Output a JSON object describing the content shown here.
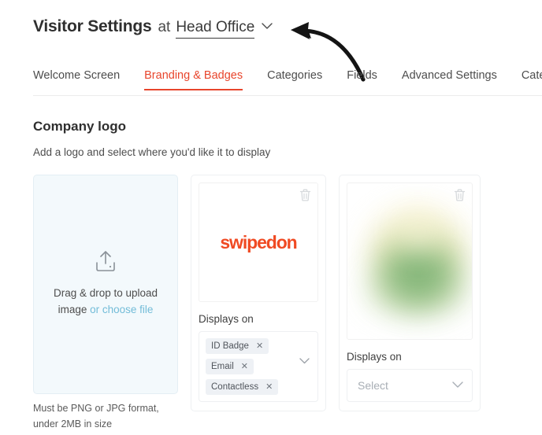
{
  "header": {
    "title": "Visitor Settings",
    "at_word": "at",
    "location": "Head Office",
    "chevron_icon": "chevron-down-icon"
  },
  "annotation": {
    "arrow_icon": "hand-drawn-left-arrow",
    "color": "#141414"
  },
  "tabs": {
    "items": [
      {
        "label": "Welcome Screen",
        "active": false
      },
      {
        "label": "Branding & Badges",
        "active": true
      },
      {
        "label": "Categories",
        "active": false
      },
      {
        "label": "Fields",
        "active": false
      },
      {
        "label": "Advanced Settings",
        "active": false
      },
      {
        "label": "Catering",
        "active": false
      }
    ],
    "active_color": "#e8452c"
  },
  "section": {
    "title": "Company logo",
    "subtitle": "Add a logo and select where you'd like it to display"
  },
  "upload": {
    "icon": "upload-icon",
    "text_primary": "Drag & drop to upload",
    "text_secondary": "image",
    "link_label": "or choose file",
    "link_color": "#72bcd8",
    "hint": "Must be PNG or JPG format, under 2MB in size"
  },
  "logo_card": {
    "preview_alt": "swipedon",
    "wordmark": "swipedon",
    "wordmark_color": "#f04a23",
    "delete_icon": "trash-icon",
    "displays_on_label": "Displays on",
    "dropdown_icon": "chevron-down-icon",
    "tags": [
      {
        "label": "ID Badge",
        "remove_icon": "close-icon"
      },
      {
        "label": "Email",
        "remove_icon": "close-icon"
      },
      {
        "label": "Contactless",
        "remove_icon": "close-icon"
      }
    ]
  },
  "photo_card": {
    "preview_alt": "blurred photo",
    "delete_icon": "trash-icon",
    "displays_on_label": "Displays on",
    "select_placeholder": "Select",
    "dropdown_icon": "chevron-down-icon"
  }
}
